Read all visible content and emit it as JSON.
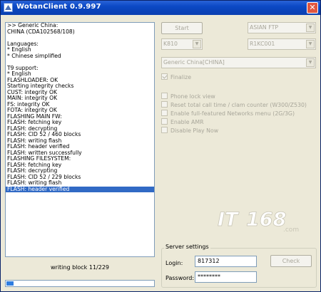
{
  "window": {
    "title": "WotanClient 0.9.997",
    "close_glyph": "✕"
  },
  "log": {
    "lines": [
      ">> Generic China:",
      "CHINA (CDA102568/108)",
      "",
      "Languages:",
      "* English",
      "* Chinese simplified",
      "",
      "T9 support:",
      "* English",
      "FLASHLOADER: OK",
      "Starting integrity checks",
      "CUST: integrity OK",
      "MAIN: integrity OK",
      "FS: integrity OK",
      "FOTA: integrity OK",
      "FLASHING MAIN FW:",
      "FLASH: fetching key",
      "FLASH: decrypting",
      "FLASH: CID 52 / 460 blocks",
      "FLASH: writing flash",
      "FLASH: header verified",
      "FLASH: written successfully",
      "FLASHING FILESYSTEM:",
      "FLASH: fetching key",
      "FLASH: decrypting",
      "FLASH: CID 52 / 229 blocks",
      "FLASH: writing flash",
      "FLASH: header verified"
    ],
    "selected_index": 27
  },
  "status": {
    "text": "writing block 11/229",
    "progress_fraction": 0.048
  },
  "controls": {
    "start_label": "Start",
    "server_combo": "ASIAN FTP",
    "model_combo": "K810",
    "firmware_combo": "R1KC001",
    "cda_combo": "Generic China[CHINA]",
    "dropdown_arrow": "▼"
  },
  "options": {
    "finalize": {
      "label": "Finalize",
      "checked": true
    },
    "phone_lock_view": {
      "label": "Phone lock view",
      "checked": false
    },
    "reset_counter": {
      "label": "Reset total call time / clam counter (W300/Z530)",
      "checked": false
    },
    "networks_menu": {
      "label": "Enable full-featured Networks menu (2G/3G)",
      "checked": false
    },
    "enable_amr": {
      "label": "Enable AMR",
      "checked": false
    },
    "disable_play_now": {
      "label": "Disable Play Now",
      "checked": false
    }
  },
  "server_settings": {
    "title": "Server settings",
    "login_label": "Login:",
    "login_value": "817312",
    "password_label": "Password:",
    "password_value": "********",
    "check_label": "Check"
  },
  "colors": {
    "titlebar": "#0b48c4",
    "selection": "#316ac5",
    "progress": "#2f7de0",
    "window_bg": "#ece9d8"
  },
  "watermark": {
    "text": "IT168",
    "domain": ".com"
  }
}
